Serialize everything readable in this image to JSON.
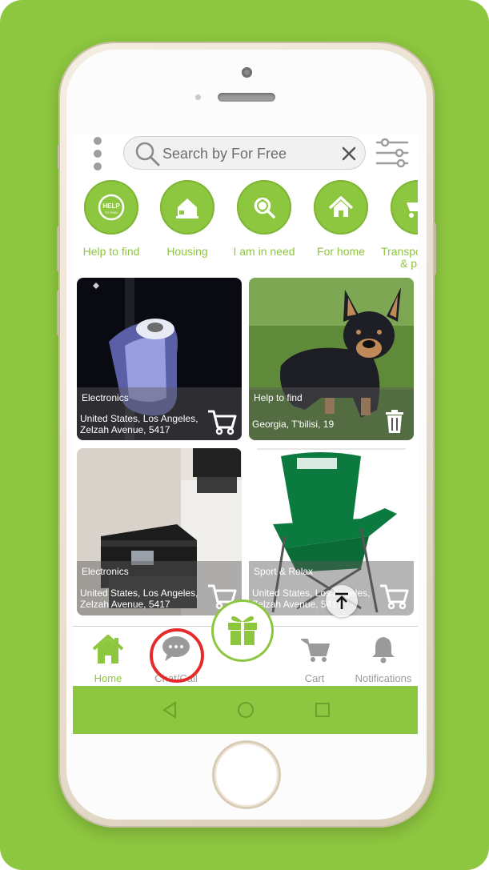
{
  "search": {
    "placeholder": "Search by For Free"
  },
  "categories": [
    {
      "label": "Help to find",
      "icon": "help-to-find-icon"
    },
    {
      "label": "Housing",
      "icon": "housing-icon"
    },
    {
      "label": "I am in need",
      "icon": "in-need-icon"
    },
    {
      "label": "For home",
      "icon": "home-icon"
    },
    {
      "label": "Transpo",
      "label2": "& pa",
      "icon": "transport-icon"
    }
  ],
  "listings": [
    {
      "category": "Electronics",
      "address_line1": "United States, Los Angeles,",
      "address_line2": "Zelzah Avenue, 5417",
      "action": "cart"
    },
    {
      "category": "Help to find",
      "address_line1": "Georgia, T'bilisi, 19",
      "address_line2": "",
      "action": "delete"
    },
    {
      "category": "Electronics",
      "address_line1": "United States, Los Angeles,",
      "address_line2": "Zelzah Avenue, 5417",
      "action": "cart"
    },
    {
      "category": "Sport & Relax",
      "address_line1": "United States, Los Angeles,",
      "address_line2": "Zelzah Avenue, 5417",
      "action": "cart"
    }
  ],
  "nav": {
    "home": "Home",
    "chat": "Chat/Call",
    "cart": "Cart",
    "notifications": "Notifications"
  },
  "colors": {
    "brand_green": "#8dc63f",
    "highlight_red": "#e42a2a",
    "inactive_gray": "#9a9a9a"
  }
}
